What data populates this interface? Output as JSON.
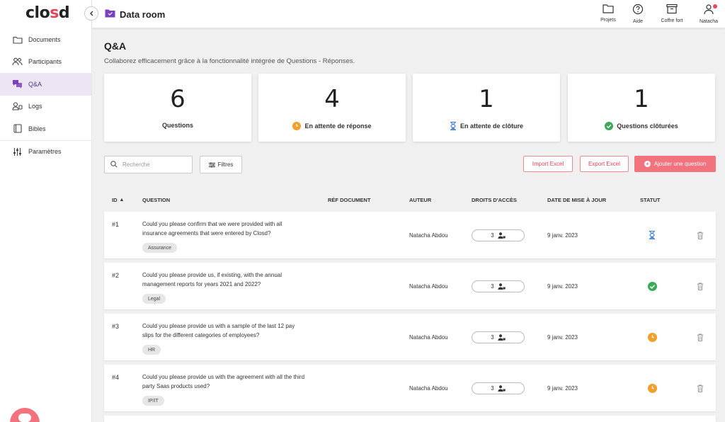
{
  "app": {
    "logo_prefix": "clo",
    "logo_mid": "s",
    "logo_suffix": "d"
  },
  "sidebar": {
    "items": [
      {
        "label": "Documents",
        "icon": "folder-icon",
        "active": false
      },
      {
        "label": "Participants",
        "icon": "users-icon",
        "active": false
      },
      {
        "label": "Q&A",
        "icon": "chat-icon",
        "active": true
      },
      {
        "label": "Logs",
        "icon": "user-log-icon",
        "active": false
      },
      {
        "label": "Bibles",
        "icon": "book-icon",
        "active": false
      },
      {
        "label": "Paramètres",
        "icon": "sliders-icon",
        "active": false
      }
    ]
  },
  "topbar": {
    "title": "Data room",
    "actions": [
      {
        "label": "Projets",
        "icon": "folder-icon"
      },
      {
        "label": "Aide",
        "icon": "help-icon"
      },
      {
        "label": "Coffre fort",
        "icon": "archive-icon"
      },
      {
        "label": "Natacha",
        "icon": "user-icon"
      }
    ]
  },
  "page": {
    "title": "Q&A",
    "subtitle": "Collaborez efficacement grâce à la fonctionnalité intégrée de Questions - Réponses."
  },
  "stats": [
    {
      "value": "6",
      "label": "Questions",
      "icon": ""
    },
    {
      "value": "4",
      "label": "En attente de réponse",
      "icon": "clock-icon"
    },
    {
      "value": "1",
      "label": "En attente de clôture",
      "icon": "hourglass-icon"
    },
    {
      "value": "1",
      "label": "Questions clôturées",
      "icon": "check-icon"
    }
  ],
  "toolbar": {
    "search_placeholder": "Recherche",
    "filters_label": "Filtres",
    "import_label": "Import Excel",
    "export_label": "Export Excel",
    "add_label": "Ajouter une question"
  },
  "table": {
    "headers": {
      "id": "ID",
      "question": "QUESTION",
      "doc_ref": "RÉF DOCUMENT",
      "author": "AUTEUR",
      "access": "DROITS D'ACCÈS",
      "date": "DATE DE MISE À JOUR",
      "status": "STATUT"
    },
    "rows": [
      {
        "id": "#1",
        "question": "Could you please confirm that we were provided with all insurance agreements that were entered by Closd?",
        "tag": "Assurance",
        "author": "Natacha Abdou",
        "access": "3",
        "date": "9 janv. 2023",
        "status": "hourglass-icon"
      },
      {
        "id": "#2",
        "question": "Could you please provide us, if existing, with the annual management reports for years 2021 and 2022?",
        "tag": "Legal",
        "author": "Natacha Abdou",
        "access": "3",
        "date": "9 janv. 2023",
        "status": "check-icon"
      },
      {
        "id": "#3",
        "question": "Could you please provide us with a sample of the last 12 pay slips for the different categories of employees?",
        "tag": "HR",
        "author": "Natacha Abdou",
        "access": "3",
        "date": "9 janv. 2023",
        "status": "clock-icon"
      },
      {
        "id": "#4",
        "question": " Could you please provide us with the agreement with all the third party Saas products used?",
        "tag": "IP/IT",
        "author": "Natacha Abdou",
        "access": "3",
        "date": "9 janv. 2023",
        "status": "clock-icon"
      }
    ]
  },
  "colors": {
    "accent": "#f2727e",
    "brand_purple": "#7b3fbf",
    "clock": "#f2a02a",
    "check": "#3aaa5a",
    "hourglass": "#3d7fd6"
  }
}
